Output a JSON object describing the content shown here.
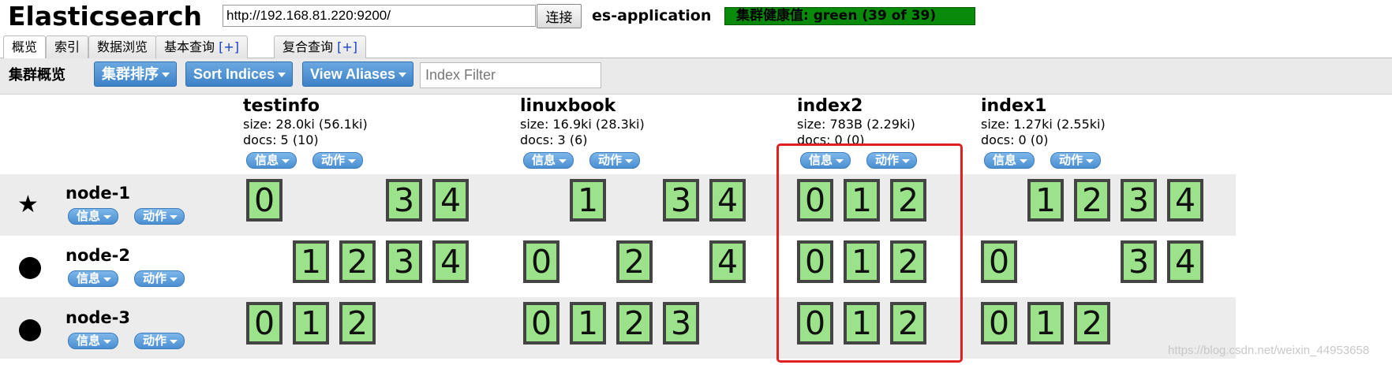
{
  "header": {
    "title": "Elasticsearch",
    "url_value": "http://192.168.81.220:9200/",
    "connect_label": "连接",
    "cluster_name": "es-application",
    "health": "集群健康值: green (39 of 39)",
    "health_color": "#0a8a0a"
  },
  "tabs": [
    {
      "label": "概览",
      "plus": ""
    },
    {
      "label": "索引",
      "plus": ""
    },
    {
      "label": "数据浏览",
      "plus": ""
    },
    {
      "label": "基本查询 ",
      "plus": "[+]"
    },
    {
      "label": "复合查询 ",
      "plus": "[+]"
    }
  ],
  "toolbar": {
    "title": "集群概览",
    "sort_cluster": "集群排序",
    "sort_indices": "Sort Indices",
    "view_aliases": "View Aliases",
    "filter_placeholder": "Index Filter"
  },
  "common": {
    "info": "信息",
    "action": "动作"
  },
  "indices": [
    {
      "name": "testinfo",
      "size": "size: 28.0ki (56.1ki)",
      "docs": "docs: 5 (10)"
    },
    {
      "name": "linuxbook",
      "size": "size: 16.9ki (28.3ki)",
      "docs": "docs: 3 (6)"
    },
    {
      "name": "index2",
      "size": "size: 783B (2.29ki)",
      "docs": "docs: 0 (0)"
    },
    {
      "name": "index1",
      "size": "size: 1.27ki (2.55ki)",
      "docs": "docs: 0 (0)"
    }
  ],
  "nodes": [
    {
      "name": "node-1",
      "icon": "star-icon",
      "master": true,
      "shards": [
        [
          "0",
          "",
          "",
          "3",
          "4"
        ],
        [
          "",
          "1",
          "",
          "3",
          "4"
        ],
        [
          "0",
          "1",
          "2"
        ],
        [
          "",
          "1",
          "2",
          "3",
          "4"
        ]
      ]
    },
    {
      "name": "node-2",
      "icon": "dot-icon",
      "master": false,
      "shards": [
        [
          "",
          "1",
          "2",
          "3",
          "4"
        ],
        [
          "0",
          "",
          "2",
          "",
          "4"
        ],
        [
          "0",
          "1",
          "2"
        ],
        [
          "0",
          "",
          "",
          "3",
          "4"
        ]
      ]
    },
    {
      "name": "node-3",
      "icon": "dot-icon",
      "master": false,
      "shards": [
        [
          "0",
          "1",
          "2",
          "",
          ""
        ],
        [
          "0",
          "1",
          "2",
          "3",
          ""
        ],
        [
          "0",
          "1",
          "2"
        ],
        [
          "0",
          "1",
          "2",
          "",
          ""
        ]
      ]
    }
  ],
  "colors": {
    "shard_fill": "#9be28a",
    "highlight": "#e02020",
    "button": "#4a8fd2"
  },
  "watermark": "https://blog.csdn.net/weixin_44953658"
}
